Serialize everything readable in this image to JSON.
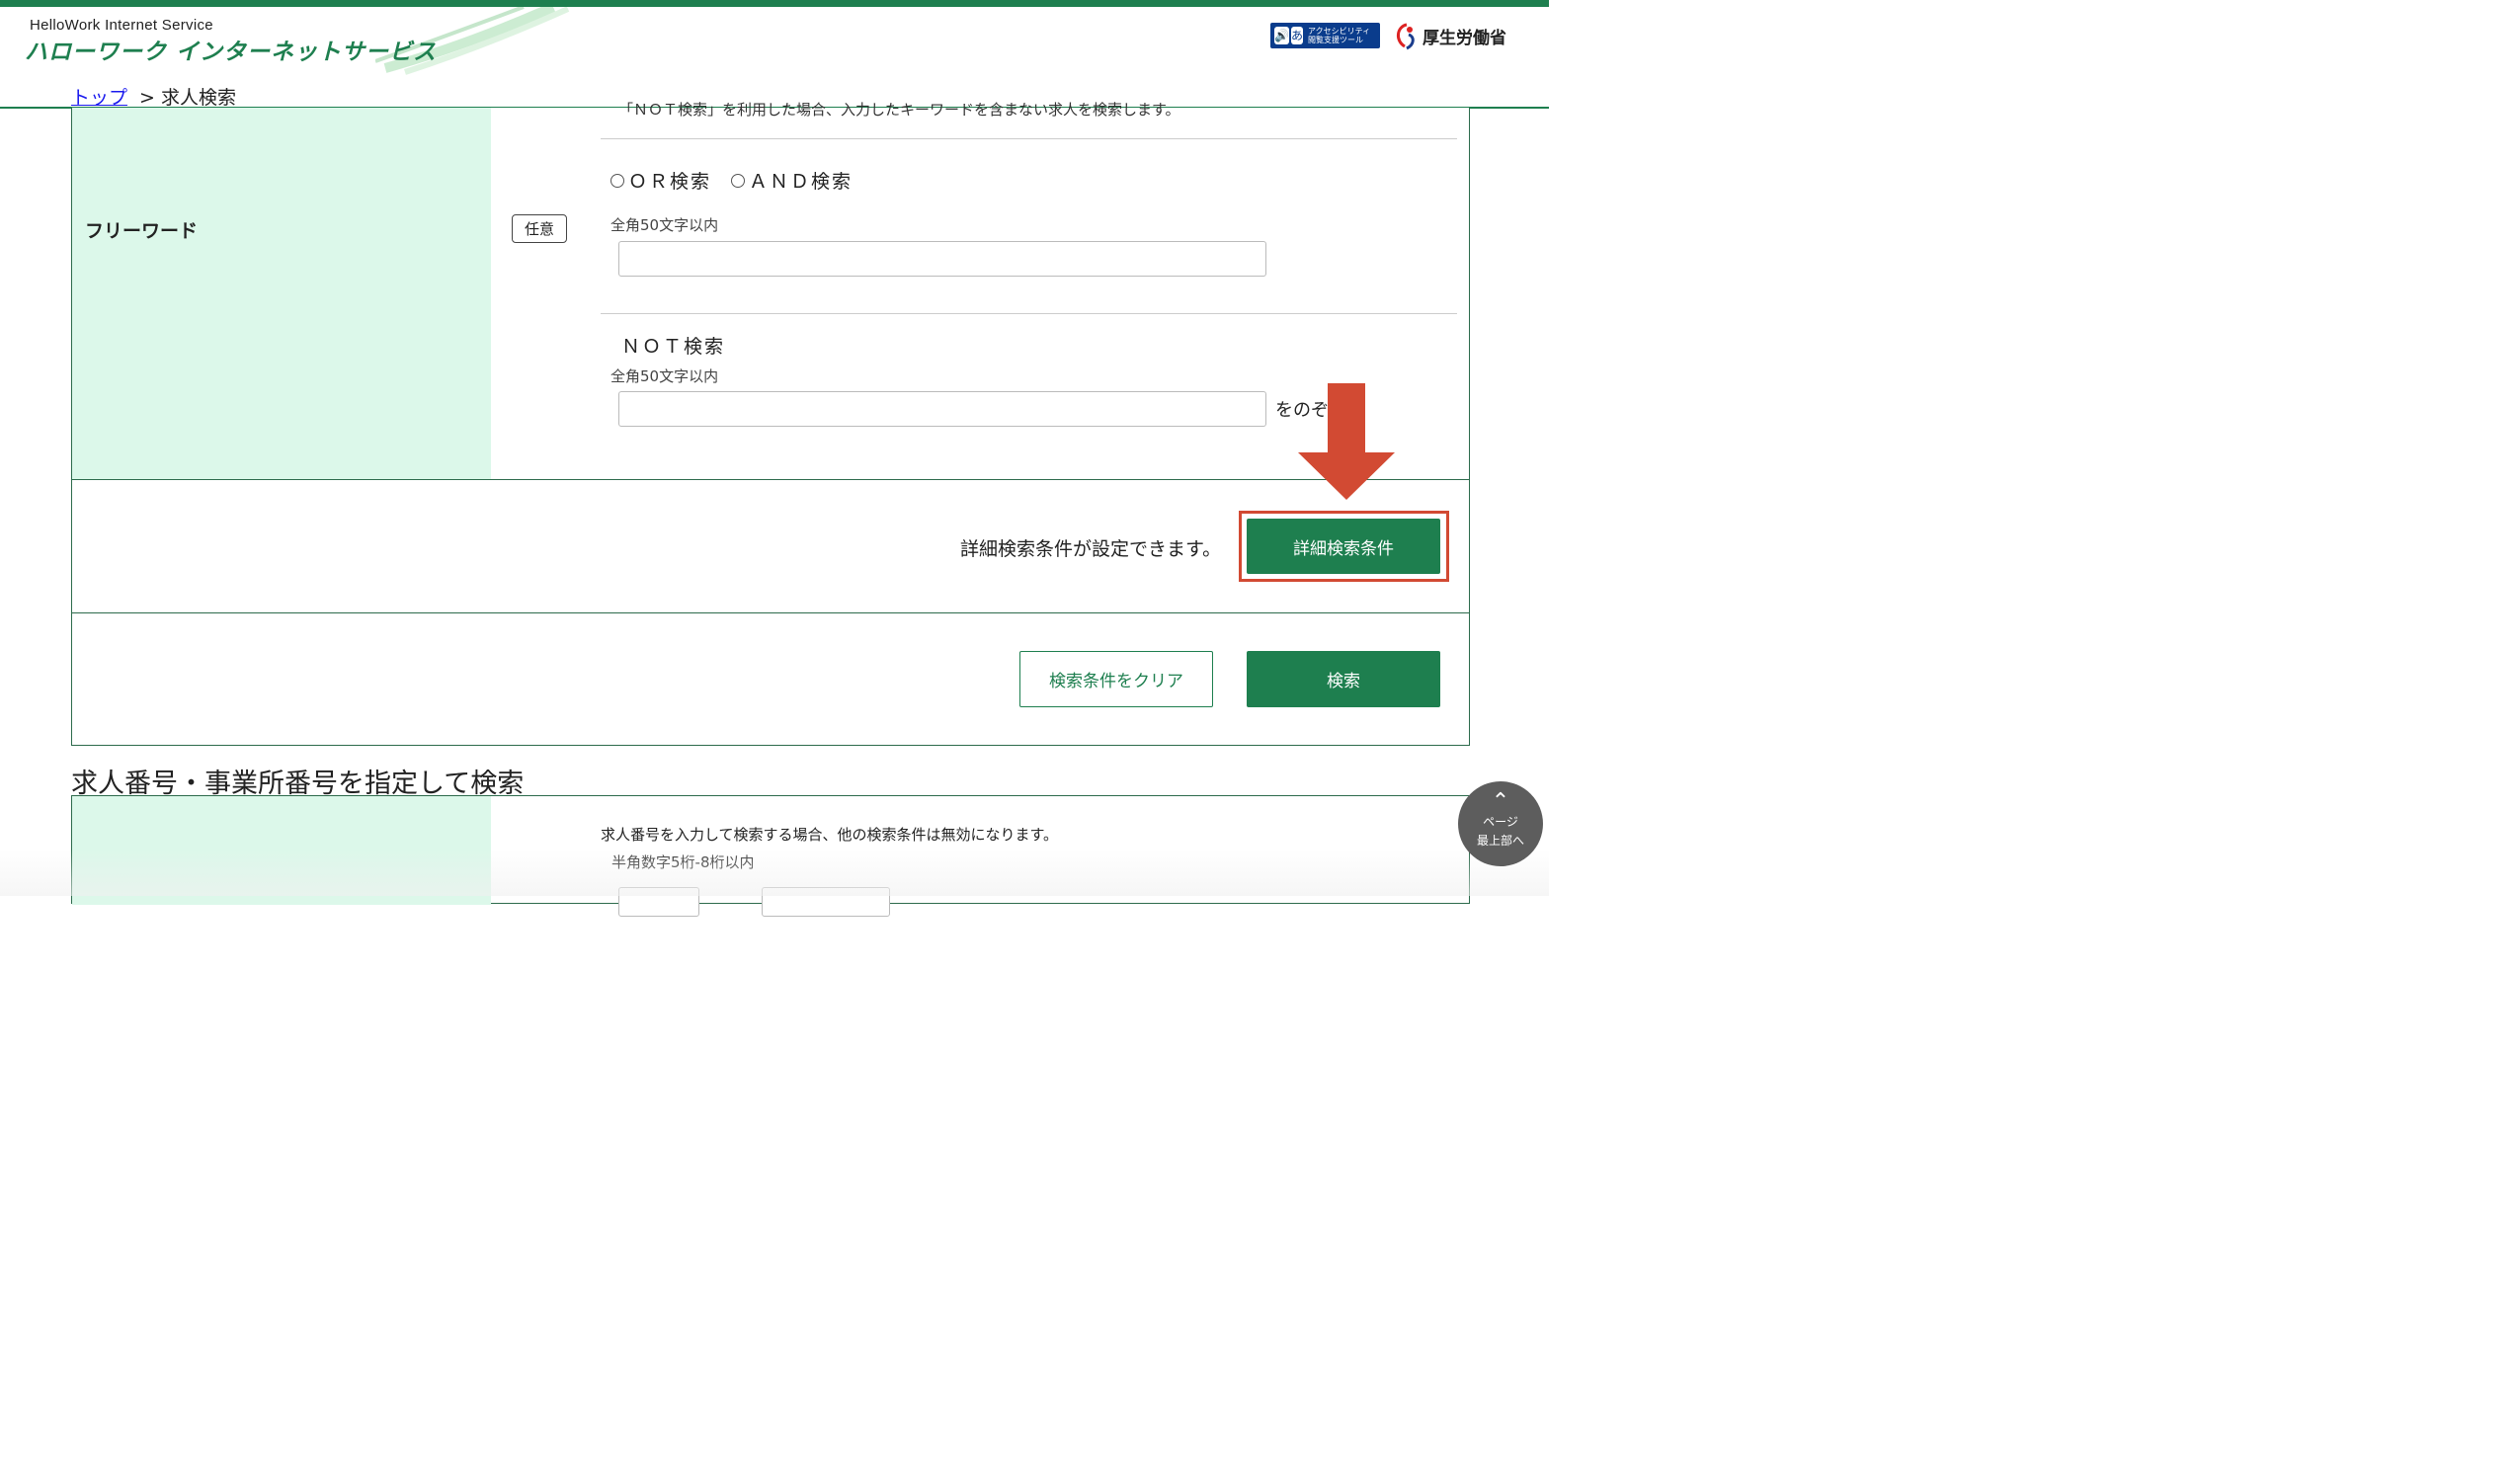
{
  "header": {
    "brand_en": "HelloWork Internet Service",
    "brand_jp": "ハローワーク インターネットサービス",
    "accessibility_badge": "アクセシビリティ閲覧支援ツール",
    "ministry_name": "厚生労働省"
  },
  "breadcrumb": {
    "home": "トップ",
    "separator": ">",
    "current": "求人検索"
  },
  "freeword": {
    "label": "フリーワード",
    "optional_badge": "任意",
    "note_top": "「ＮＯＴ検索」を利用した場合、入力したキーワードを含まない求人を検索します。",
    "radio_or": "ＯＲ検索",
    "radio_and": "ＡＮＤ検索",
    "hint": "全角50文字以内",
    "input_value": "",
    "not_title": "ＮＯＴ検索",
    "not_hint": "全角50文字以内",
    "not_input_value": "",
    "except_text": "をのぞ"
  },
  "detail": {
    "text": "詳細検索条件が設定できます。",
    "button": "詳細検索条件"
  },
  "actions": {
    "clear": "検索条件をクリア",
    "search": "検索"
  },
  "section2": {
    "title": "求人番号・事業所番号を指定して検索",
    "note": "求人番号を入力して検索する場合、他の検索条件は無効になります。",
    "hint": "半角数字5桁-8桁以内"
  },
  "page_top": {
    "line1": "ページ",
    "line2": "最上部へ"
  },
  "colors": {
    "primary_green": "#1e7f4f",
    "label_bg": "#dcf8ea",
    "highlight_red": "#d24a33"
  }
}
